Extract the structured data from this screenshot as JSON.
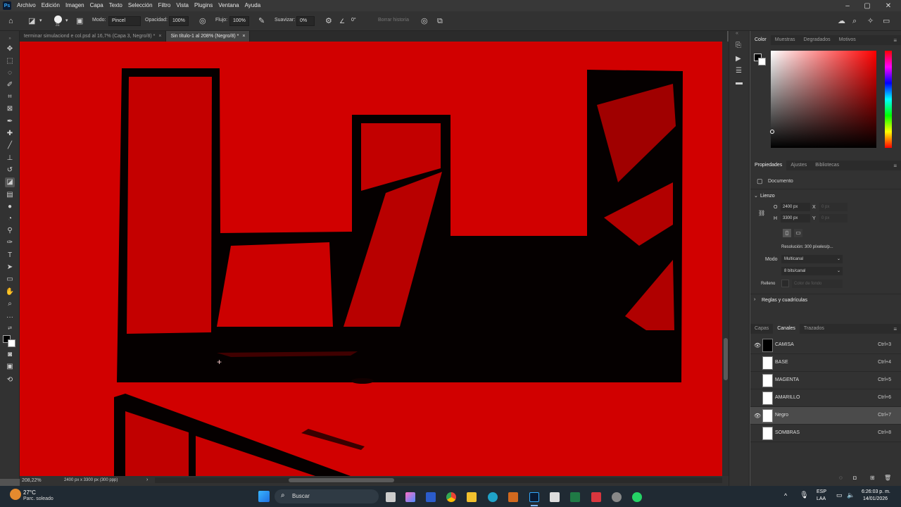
{
  "menubar": {
    "app_logo": "Ps",
    "items": [
      "Archivo",
      "Edición",
      "Imagen",
      "Capa",
      "Texto",
      "Selección",
      "Filtro",
      "Vista",
      "Plugins",
      "Ventana",
      "Ayuda"
    ]
  },
  "options": {
    "brush_size": "31",
    "mode_label": "Modo:",
    "mode_value": "Pincel",
    "opacity_label": "Opacidad:",
    "opacity_value": "100%",
    "flow_label": "Flujo:",
    "flow_value": "100%",
    "smooth_label": "Suavizar:",
    "smooth_value": "0%",
    "angle_value": "0°",
    "erase_history": "Borrar historia"
  },
  "tabs": [
    {
      "label": "terminar simulaciond e col.psd al 16,7% (Capa 3, Negro/8) *",
      "close": "×"
    },
    {
      "label": "Sin título-1 al 208% (Negro/8) *",
      "close": "×"
    }
  ],
  "status": {
    "zoom": "208,22%",
    "doc_size": "2400 px x 3300 px (300 ppp)",
    "arrow": "›"
  },
  "color_panel": {
    "tabs": [
      "Color",
      "Muestras",
      "Degradados",
      "Motivos"
    ]
  },
  "properties": {
    "tabs": [
      "Propiedades",
      "Ajustes",
      "Bibliotecas"
    ],
    "doc_label": "Documento",
    "canvas_section": "Lienzo",
    "w_label": "O",
    "w_value": "2400 px",
    "h_label": "H",
    "h_value": "3300 px",
    "x_label": "X",
    "x_placeholder": "0 px",
    "y_label": "Y",
    "y_placeholder": "0 px",
    "resolution": "Resolución: 300 píxeles/p...",
    "mode_label": "Modo",
    "mode_value": "Multicanal",
    "depth_value": "8 bits/canal",
    "fill_label": "Relleno",
    "fill_value": "Color de fondo",
    "rulers_section": "Reglas y cuadrículas"
  },
  "channels_panel": {
    "tabs": [
      "Capas",
      "Canales",
      "Trazados"
    ],
    "channels": [
      {
        "name": "CAMISA",
        "shortcut": "Ctrl+3",
        "visible": true,
        "selected": false
      },
      {
        "name": "BASE",
        "shortcut": "Ctrl+4",
        "visible": false,
        "selected": false
      },
      {
        "name": "MAGENTA",
        "shortcut": "Ctrl+5",
        "visible": false,
        "selected": false
      },
      {
        "name": "AMARILLO",
        "shortcut": "Ctrl+6",
        "visible": false,
        "selected": false
      },
      {
        "name": "Negro",
        "shortcut": "Ctrl+7",
        "visible": true,
        "selected": true
      },
      {
        "name": "SOMBRAS",
        "shortcut": "Ctrl+8",
        "visible": false,
        "selected": false
      }
    ]
  },
  "taskbar": {
    "weather_temp": "27°C",
    "weather_desc": "Parc. soleado",
    "search_label": "Buscar",
    "lang": "ESP",
    "lang_sub": "LAA",
    "time": "6:26:03 p. m.",
    "date": "14/01/2026"
  },
  "colors": {
    "canvas_red": "#d10000",
    "ink": "#000000",
    "panel_bg": "#323232"
  }
}
